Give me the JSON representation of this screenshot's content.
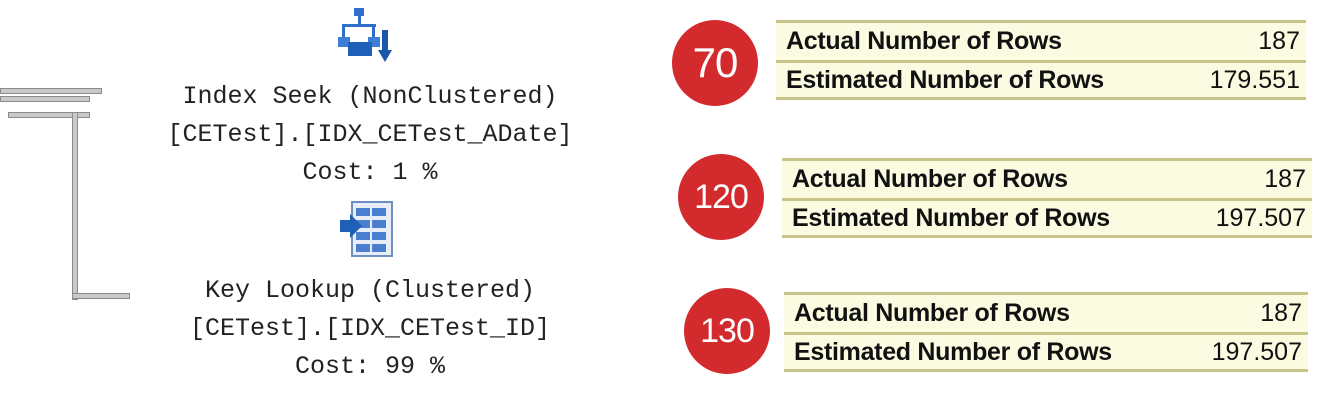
{
  "plan": {
    "operators": [
      {
        "icon": "index-seek-icon",
        "name": "Index Seek (NonClustered)",
        "object": "[CETest].[IDX_CETest_ADate]",
        "cost": "Cost: 1 %"
      },
      {
        "icon": "key-lookup-icon",
        "name": "Key Lookup (Clustered)",
        "object": "[CETest].[IDX_CETest_ID]",
        "cost": "Cost: 99 %"
      }
    ]
  },
  "stats": [
    {
      "badge": "70",
      "actual_label": "Actual Number of Rows",
      "actual_value": "187",
      "estimated_label": "Estimated Number of Rows",
      "estimated_value": "179.551"
    },
    {
      "badge": "120",
      "actual_label": "Actual Number of Rows",
      "actual_value": "187",
      "estimated_label": "Estimated Number of Rows",
      "estimated_value": "197.507"
    },
    {
      "badge": "130",
      "actual_label": "Actual Number of Rows",
      "actual_value": "187",
      "estimated_label": "Estimated Number of Rows",
      "estimated_value": "197.507"
    }
  ],
  "colors": {
    "badge": "#d32a2e",
    "table_bg": "#fbfbe1",
    "table_rule": "#c7c58a"
  }
}
